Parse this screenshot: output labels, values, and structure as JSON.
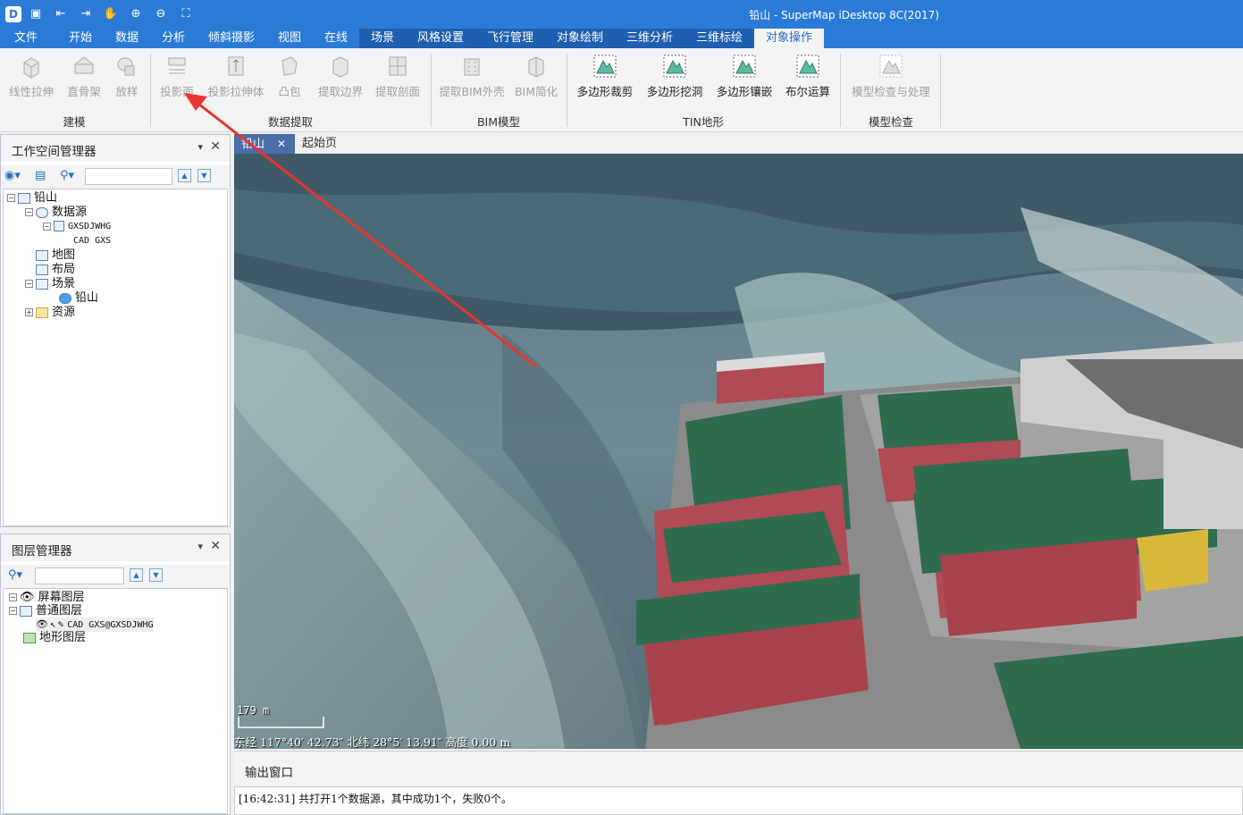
{
  "window": {
    "title": "铅山 - SuperMap iDesktop 8C(2017)",
    "accent": "#2b7bd6"
  },
  "quick_access": [
    "save-icon",
    "import-icon",
    "export-icon",
    "pan-icon",
    "zoom-in-icon",
    "zoom-out-icon",
    "full-extent-icon"
  ],
  "menu_tabs": [
    "文件",
    "开始",
    "数据",
    "分析",
    "倾斜摄影",
    "视图",
    "在线",
    "场景",
    "风格设置",
    "飞行管理",
    "对象绘制",
    "三维分析",
    "三维标绘",
    "对象操作"
  ],
  "ribbon": {
    "modeling": {
      "group": "建模",
      "buttons": [
        "线性拉伸",
        "直骨架",
        "放样"
      ]
    },
    "extract": {
      "group": "数据提取",
      "buttons": [
        "投影面",
        "投影拉伸体",
        "凸包",
        "提取边界",
        "提取剖面"
      ]
    },
    "bim": {
      "group": "BIM模型",
      "buttons": [
        "提取BIM外壳",
        "BIM简化"
      ]
    },
    "tin": {
      "group": "TIN地形",
      "buttons": [
        "多边形裁剪",
        "多边形挖洞",
        "多边形镶嵌",
        "布尔运算"
      ]
    },
    "check": {
      "group": "模型检查",
      "buttons": [
        "模型检查与处理"
      ]
    }
  },
  "workspace": {
    "title": "工作空间管理器",
    "tree": {
      "root": "铅山",
      "datasources": "数据源",
      "datasource_name": "GXSDJWHG",
      "dataset_name": "CAD GXS",
      "maps": "地图",
      "layouts": "布局",
      "scenes": "场景",
      "scene_name": "铅山",
      "resources": "资源"
    }
  },
  "layers": {
    "title": "图层管理器",
    "screen_layers": "屏幕图层",
    "normal_layers": "普通图层",
    "layer_item": "CAD GXS@GXSDJWHG",
    "terrain_layers": "地形图层"
  },
  "doc_tabs": [
    "铅山",
    "起始页"
  ],
  "scene": {
    "scale": "179 m",
    "coords": "东经 117°40′ 42.73″   北纬 28°5′ 13.91″   高度 0.00 m"
  },
  "output": {
    "title": "输出窗口",
    "message": "[16:42:31] 共打开1个数据源，其中成功1个，失败0个。"
  }
}
